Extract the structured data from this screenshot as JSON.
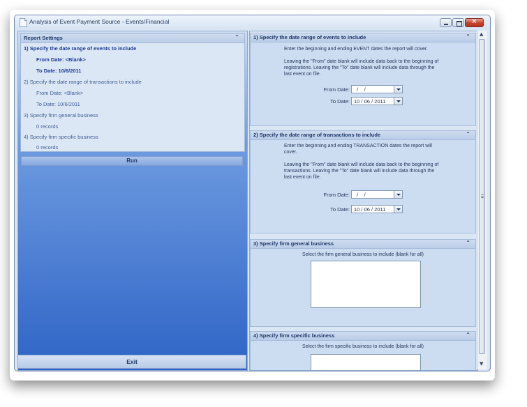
{
  "window": {
    "title": "Analysis of Event Payment Source - Events/Financial"
  },
  "left": {
    "header": "Report Settings",
    "items": [
      {
        "text": "1)  Specify the date range of events to include",
        "bold": true
      },
      {
        "text": "From Date:  <Blank>",
        "bold": true
      },
      {
        "text": "To Date:  10/6/2011",
        "bold": true
      },
      {
        "text": "2)  Specify the date range of transactions to include",
        "bold": false
      },
      {
        "text": "From Date:  <Blank>",
        "bold": false
      },
      {
        "text": "To Date:  10/6/2011",
        "bold": false
      },
      {
        "text": "3)  Specify firm general business",
        "bold": false
      },
      {
        "text": "0 records",
        "bold": false
      },
      {
        "text": "4)  Specify firm specific business",
        "bold": false
      },
      {
        "text": "0 records",
        "bold": false
      }
    ],
    "run_label": "Run",
    "exit_label": "Exit"
  },
  "sections": {
    "s1": {
      "title": "1)  Specify the date range of events to include",
      "desc1": "Enter the beginning and ending EVENT dates the report will cover.",
      "desc2": "Leaving the \"From\" date blank will include data back to the beginning of registrations. Leaving the \"To\" date blank will include data through the last event on file.",
      "from_label": "From Date:",
      "from_value": "  /    /",
      "to_label": "To Date:",
      "to_value": "10 / 06 / 2011"
    },
    "s2": {
      "title": "2)  Specify the date range of transactions to include",
      "desc1": "Enter the beginning and ending TRANSACTION dates the report will cover.",
      "desc2": "Leaving the \"From\" date blank will include data back to the beginning of transactions. Leaving the \"To\" date blank will include data through the last event on file.",
      "from_label": "From Date:",
      "from_value": "  /    /",
      "to_label": "To Date:",
      "to_value": "10 / 06 / 2011"
    },
    "s3": {
      "title": "3)  Specify firm general business",
      "desc": "Select the firm general business to include (blank for all)"
    },
    "s4": {
      "title": "4)  Specify firm specific business",
      "desc": "Select the firm specific business to include (blank for all)"
    }
  }
}
